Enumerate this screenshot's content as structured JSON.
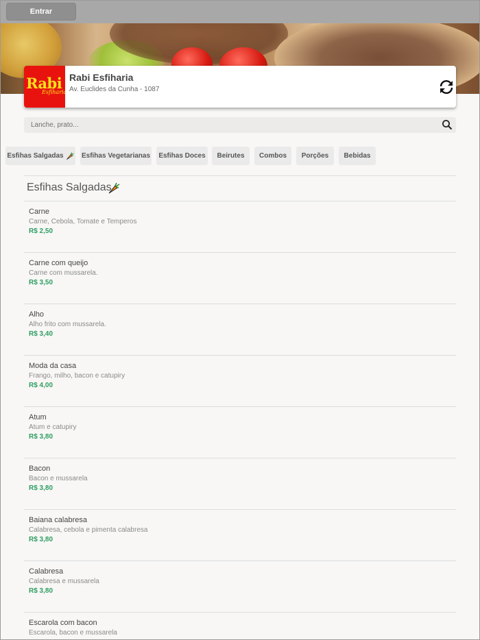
{
  "header": {
    "login_label": "Entrar"
  },
  "store": {
    "logo_text": "Rabi",
    "logo_subtext": "Esfiharia",
    "name": "Rabi Esfiharia",
    "address": "Av. Euclides da Cunha - 1087"
  },
  "search": {
    "placeholder": "Lanche, prato..."
  },
  "categories": [
    "Esfihas Salgadas",
    "Esfihas Vegetarianas",
    "Esfihas Doces",
    "Beirutes",
    "Combos",
    "Porções",
    "Bebidas"
  ],
  "section": {
    "title": "Esfihas Salgadas"
  },
  "items": [
    {
      "name": "Carne",
      "description": "Carne, Cebola, Tomate e Temperos",
      "price": "R$ 2,50"
    },
    {
      "name": "Carne com queijo",
      "description": "Carne com mussarela.",
      "price": "R$ 3,50"
    },
    {
      "name": "Alho",
      "description": "Alho frito com mussarela.",
      "price": "R$ 3,40"
    },
    {
      "name": "Moda da casa",
      "description": "Frango, milho, bacon e catupiry",
      "price": "R$ 4,00"
    },
    {
      "name": "Atum",
      "description": "Atum e catupiry",
      "price": "R$ 3,80"
    },
    {
      "name": "Bacon",
      "description": "Bacon e mussarela",
      "price": "R$ 3,80"
    },
    {
      "name": "Baiana calabresa",
      "description": "Calabresa, cebola e pimenta calabresa",
      "price": "R$ 3,80"
    },
    {
      "name": "Calabresa",
      "description": "Calabresa e mussarela",
      "price": "R$ 3,80"
    },
    {
      "name": "Escarola com bacon",
      "description": "Escarola, bacon e mussarela",
      "price": ""
    }
  ],
  "icons": {
    "refresh": "refresh-icon",
    "search": "search-icon",
    "category": "carrot-icon"
  },
  "colors": {
    "price": "#2f9d62",
    "logo_bg": "#e8130e",
    "logo_text": "#f7e21b"
  }
}
